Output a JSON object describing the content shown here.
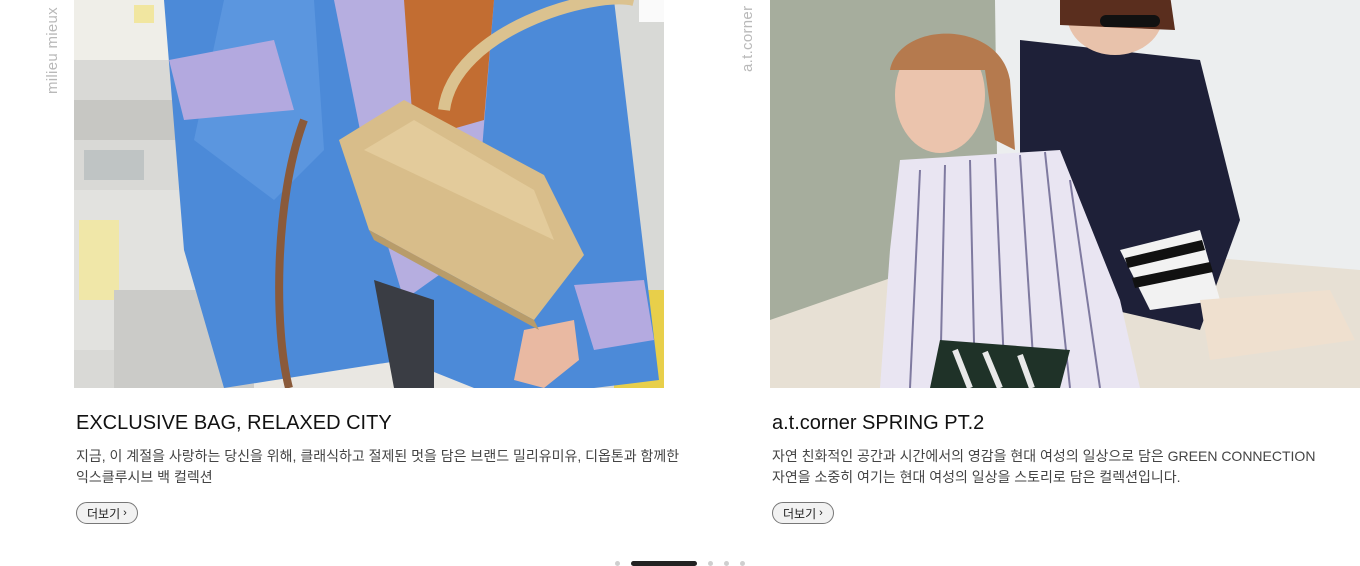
{
  "cards": [
    {
      "brand_vertical": "milieu mieux",
      "title": "EXCLUSIVE BAG, RELAXED CITY",
      "desc_lines": [
        "지금, 이 계절을 사랑하는 당신을 위해, 클래식하고 절제된 멋을 담은 브랜드 밀리유미유, 디옵톤과 함께한",
        "익스클루시브 백 컬렉션"
      ],
      "more_label": "더보기",
      "image_alt": "Model in blue shirt holding beige shoulder bag by office copier"
    },
    {
      "brand_vertical": "a.t.corner",
      "title": "a.t.corner SPRING PT.2",
      "desc_lines": [
        "자연 친화적인 공간과 시간에서의 영감을 현대 여성의 일상으로 담은 GREEN CONNECTION",
        "자연을 소중히 여기는 현대 여성의 일상을 스토리로 담은 컬렉션입니다."
      ],
      "more_label": "더보기",
      "image_alt": "Two models in striped and navy shirts sitting on floor"
    }
  ],
  "pager": {
    "count": 5,
    "active_index": 1
  },
  "icons": {
    "more_chevron": "chevron-right-icon"
  }
}
